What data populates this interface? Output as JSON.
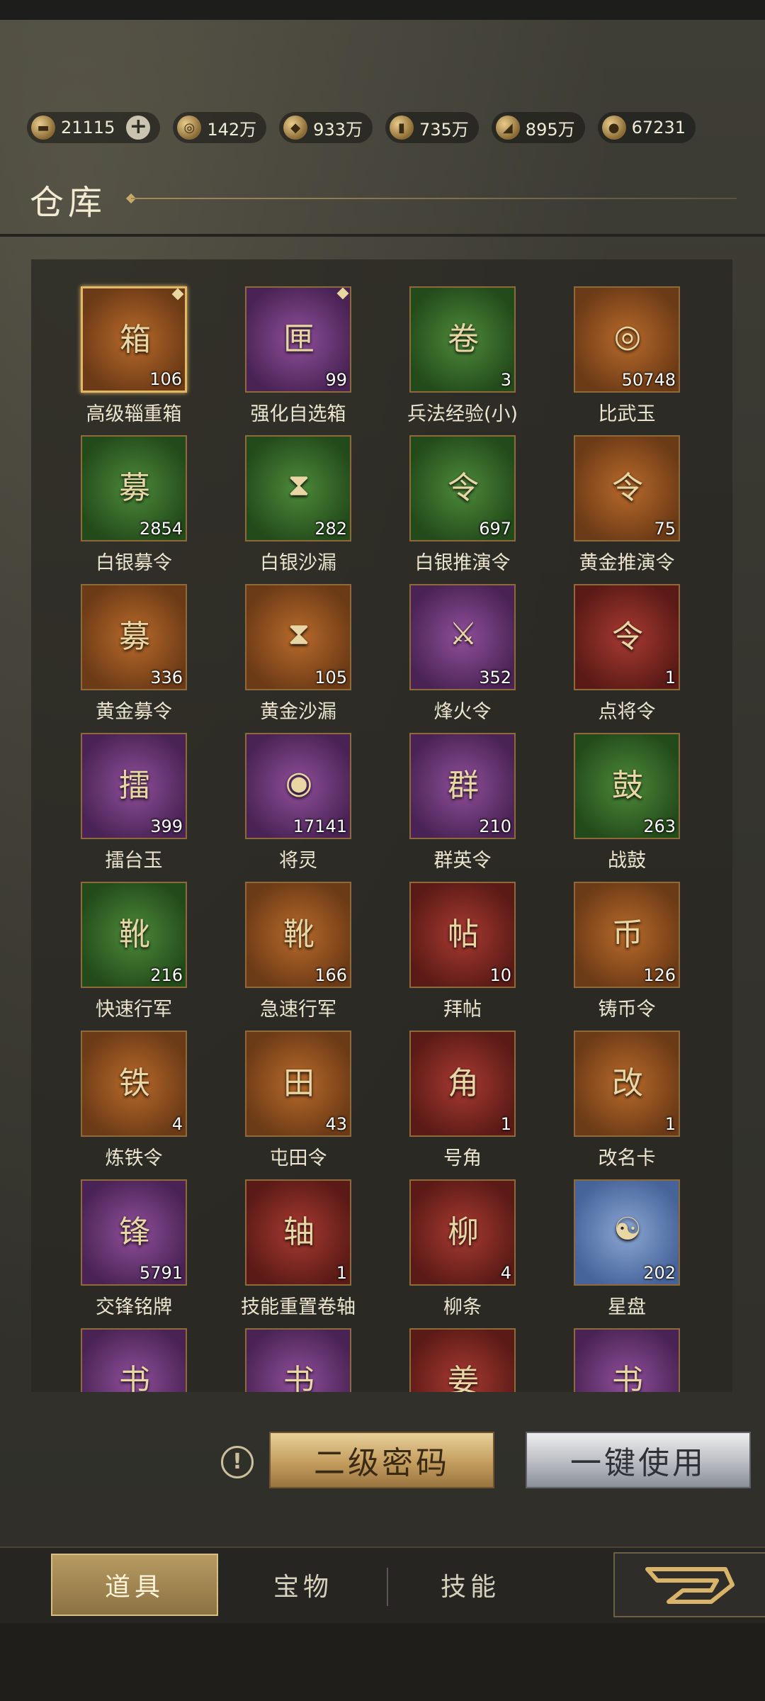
{
  "resources": [
    {
      "icon": "gold-ingot-icon",
      "glyph": "▬",
      "value": "21115",
      "has_plus": true
    },
    {
      "icon": "copper-coin-icon",
      "glyph": "◎",
      "value": "142万"
    },
    {
      "icon": "grain-sack-icon",
      "glyph": "◆",
      "value": "933万"
    },
    {
      "icon": "wood-log-icon",
      "glyph": "▮",
      "value": "735万"
    },
    {
      "icon": "iron-ingot-icon",
      "glyph": "◢",
      "value": "895万"
    },
    {
      "icon": "bronze-medal-icon",
      "glyph": "●",
      "value": "67231"
    }
  ],
  "title": "仓库",
  "items": [
    {
      "name": "高级辎重箱",
      "count": "106",
      "quality": "orange",
      "glyph": "箱",
      "selected": true,
      "gem": true
    },
    {
      "name": "强化自选箱",
      "count": "99",
      "quality": "purple",
      "glyph": "匣",
      "gem": true
    },
    {
      "name": "兵法经验(小)",
      "count": "3",
      "quality": "green",
      "glyph": "卷"
    },
    {
      "name": "比武玉",
      "count": "50748",
      "quality": "orange",
      "glyph": "◎"
    },
    {
      "name": "白银募令",
      "count": "2854",
      "quality": "green",
      "glyph": "募"
    },
    {
      "name": "白银沙漏",
      "count": "282",
      "quality": "green",
      "glyph": "⧗"
    },
    {
      "name": "白银推演令",
      "count": "697",
      "quality": "green",
      "glyph": "令"
    },
    {
      "name": "黄金推演令",
      "count": "75",
      "quality": "orange",
      "glyph": "令"
    },
    {
      "name": "黄金募令",
      "count": "336",
      "quality": "orange",
      "glyph": "募"
    },
    {
      "name": "黄金沙漏",
      "count": "105",
      "quality": "orange",
      "glyph": "⧗"
    },
    {
      "name": "烽火令",
      "count": "352",
      "quality": "purple",
      "glyph": "⚔"
    },
    {
      "name": "点将令",
      "count": "1",
      "quality": "red",
      "glyph": "令"
    },
    {
      "name": "擂台玉",
      "count": "399",
      "quality": "purple",
      "glyph": "擂"
    },
    {
      "name": "将灵",
      "count": "17141",
      "quality": "purple",
      "glyph": "◉"
    },
    {
      "name": "群英令",
      "count": "210",
      "quality": "purple",
      "glyph": "群"
    },
    {
      "name": "战鼓",
      "count": "263",
      "quality": "green",
      "glyph": "鼓"
    },
    {
      "name": "快速行军",
      "count": "216",
      "quality": "green",
      "glyph": "靴"
    },
    {
      "name": "急速行军",
      "count": "166",
      "quality": "orange",
      "glyph": "靴"
    },
    {
      "name": "拜帖",
      "count": "10",
      "quality": "red",
      "glyph": "帖"
    },
    {
      "name": "铸币令",
      "count": "126",
      "quality": "orange",
      "glyph": "币"
    },
    {
      "name": "炼铁令",
      "count": "4",
      "quality": "orange",
      "glyph": "铁"
    },
    {
      "name": "屯田令",
      "count": "43",
      "quality": "orange",
      "glyph": "田"
    },
    {
      "name": "号角",
      "count": "1",
      "quality": "red",
      "glyph": "角"
    },
    {
      "name": "改名卡",
      "count": "1",
      "quality": "orange",
      "glyph": "改"
    },
    {
      "name": "交锋铭牌",
      "count": "5791",
      "quality": "purple",
      "glyph": "锋"
    },
    {
      "name": "技能重置卷轴",
      "count": "1",
      "quality": "red",
      "glyph": "轴"
    },
    {
      "name": "柳条",
      "count": "4",
      "quality": "red",
      "glyph": "柳"
    },
    {
      "name": "星盘",
      "count": "202",
      "quality": "blue",
      "glyph": "☯"
    },
    {
      "name": "",
      "count": "",
      "quality": "purple",
      "glyph": "书"
    },
    {
      "name": "",
      "count": "",
      "quality": "purple",
      "glyph": "书"
    },
    {
      "name": "",
      "count": "",
      "quality": "red",
      "glyph": "姜"
    },
    {
      "name": "",
      "count": "",
      "quality": "purple",
      "glyph": "书"
    }
  ],
  "buttons": {
    "secondary_password": "二级密码",
    "use_all": "一键使用",
    "warning_glyph": "!"
  },
  "tabs": [
    {
      "label": "道具",
      "active": true
    },
    {
      "label": "宝物",
      "active": false
    },
    {
      "label": "技能",
      "active": false
    }
  ]
}
